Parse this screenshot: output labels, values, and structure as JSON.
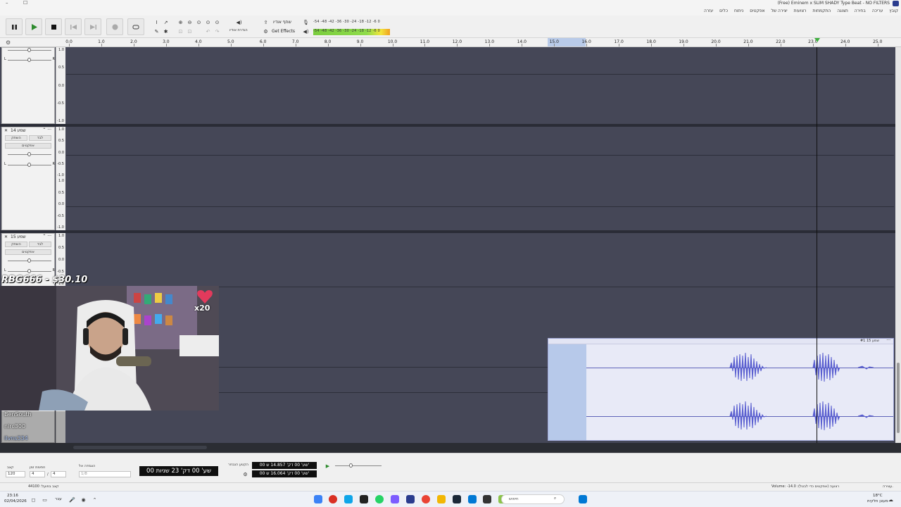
{
  "window": {
    "title": "(Free) Eminem x SLIM SHADY Type Beat - NO FILTERS",
    "minimize_glyph": "–",
    "maximize_glyph": "☐"
  },
  "menu": {
    "items": [
      "קובץ",
      "עריכה",
      "בחירה",
      "תצוגה",
      "התקמחות",
      "רצועות",
      "יצירה של",
      "אפקטים",
      "ניתוח",
      "כלים",
      "עזרה"
    ]
  },
  "toolbar": {
    "share_audio_label": "שתף אודיו",
    "get_effects_label": "Get Effects",
    "audio_setup_label": "הגדרת אודיו",
    "record_meter_scale": "-54 -48 -42 -36 -30 -24 -18 -12  -6  0",
    "play_meter_scale": "-54 -48 -42 -36 -30 -24 -18 -12  -6  0",
    "record_meter_fill_pct": 0.0,
    "play_meter_fill_pct": 0.92
  },
  "ruler": {
    "ticks": [
      "0.0",
      "1.0",
      "2.0",
      "3.0",
      "4.0",
      "5.0",
      "6.0",
      "7.0",
      "8.0",
      "9.0",
      "10.0",
      "11.0",
      "12.0",
      "13.0",
      "14.0",
      "15.0",
      "16.0",
      "17.0",
      "18.0",
      "19.0",
      "20.0",
      "21.0",
      "22.0",
      "23.0",
      "24.0",
      "25.0"
    ],
    "selection_start": 14.857,
    "selection_end": 16.064,
    "playhead": 23.2
  },
  "tracks": {
    "scale_labels": [
      "1.0",
      "0.5",
      "0.0",
      "-0.5",
      "-1.0"
    ],
    "track14": {
      "name": "שמע 14",
      "mute": "השתק",
      "solo": "לבד",
      "effects": "אפקטים",
      "pan_l": "L",
      "pan_r": "R"
    },
    "track15": {
      "name": "שמע 15",
      "mute": "השתק",
      "solo": "לבד",
      "effects": "אפקטים",
      "pan_l": "L",
      "pan_r": "R"
    },
    "clip_name": "שמע 15 #1",
    "clip_menu": "···"
  },
  "bottom": {
    "tempo_label": "קצב",
    "tempo_value": "120",
    "time_sig_label": "חתימת זמן",
    "time_sig_num": "4",
    "time_sig_den": "4",
    "snap_label": "הצמדה אל",
    "snap_value": "1/8",
    "big_time": "00 שע' 00 דק' 23 שניות",
    "selection_label": "הקטע הנבחר",
    "sel_start": "00 שע' 00 דק' 14.857 ש'",
    "sel_end": "00 שע' 00 דק' 16.064 ש'"
  },
  "status": {
    "left": "44100 :קצב בפועל",
    "right": "Volume: -14.0 :רצועה (אפקטים כדי לבטל)",
    "far_right": "עצירה."
  },
  "taskbar": {
    "time": "23:16",
    "date": "02/04/2026",
    "weather": "18°C",
    "weather_desc": "מעונן חלקית",
    "lang": "עבר",
    "search_placeholder": "חיפוש"
  },
  "overlay": {
    "donation_text": "RBG666 - $30.10",
    "multiplier": "x20",
    "chat_users": [
      "BenSouth",
      "nirc300",
      "ilvns334"
    ]
  },
  "colors": {
    "lane_bg": "#454757",
    "clip_bg": "#e8eaf7",
    "wave": "#5a5fd0",
    "selection": "#b7c9ea",
    "meter_green": "#8fdc4a"
  }
}
